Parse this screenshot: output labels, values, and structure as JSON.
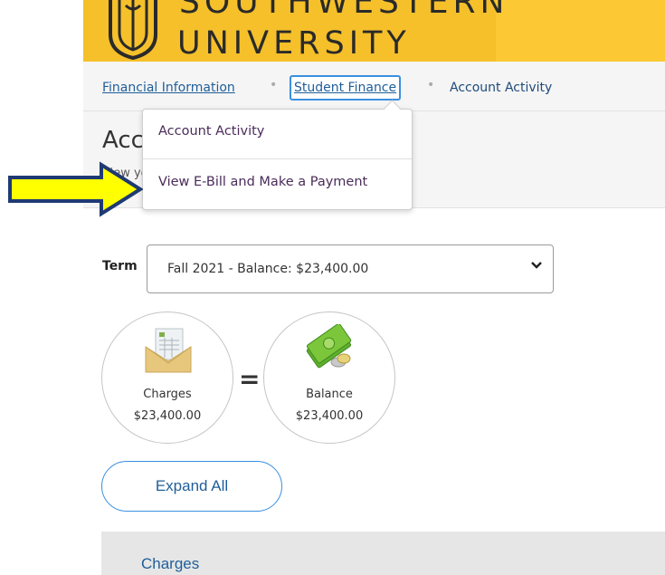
{
  "header": {
    "wordmark_top": "SOUTHWESTERN",
    "wordmark_bottom": "UNIVERSITY",
    "colors": {
      "banner": "#fcc935",
      "logo_bg": "#f5c02a"
    }
  },
  "breadcrumb": {
    "items": [
      {
        "label": "Financial Information"
      },
      {
        "label": "Student Finance"
      },
      {
        "label": "Account Activity"
      }
    ],
    "separator": "•"
  },
  "page": {
    "title": "Account Activity",
    "subtitle": "View your account activity"
  },
  "dropdown_menu": {
    "items": [
      {
        "label": "Account Activity"
      },
      {
        "label": "View E-Bill and Make a Payment"
      }
    ]
  },
  "annotation": {
    "arrow_color": "#ffff00",
    "arrow_outline": "#1f3a73"
  },
  "term": {
    "label": "Term",
    "selected": "Fall 2021 - Balance: $23,400.00"
  },
  "summary": {
    "charges": {
      "label": "Charges",
      "amount": "$23,400.00"
    },
    "equals": "=",
    "balance": {
      "label": "Balance",
      "amount": "$23,400.00"
    }
  },
  "actions": {
    "expand_all": "Expand All"
  },
  "sections": {
    "charges_title": "Charges"
  }
}
